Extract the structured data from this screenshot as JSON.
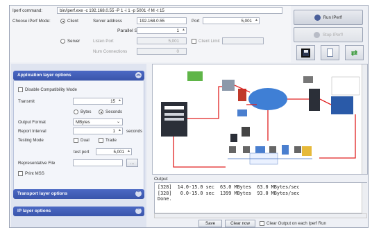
{
  "header": {
    "iperf_command_label": "Iperf command:",
    "iperf_command_value": "bin/iperf.exe -c 192.168.0.55 -P 1 -i 1 -p 5001 -f M -t 15",
    "choose_mode_label": "Choose iPerf Mode:",
    "client_label": "Client",
    "server_label": "Server",
    "server_address_label": "Server address",
    "server_address_value": "192.168.0.55",
    "port_label": "Port",
    "port_value": "5,001",
    "parallel_streams_label": "Parallel Streams",
    "parallel_streams_value": "1",
    "listen_port_label": "Listen Port",
    "listen_port_value": "5,001",
    "client_limit_label": "Client Limit",
    "num_connections_label": "Num Connections",
    "num_connections_value": "0"
  },
  "actions": {
    "run_label": "Run IPerf!",
    "stop_label": "Stop IPerf!"
  },
  "app_layer": {
    "title": "Application layer options",
    "disable_compat_label": "Disable Compatibility Mode",
    "transmit_label": "Transmit",
    "transmit_value": "15",
    "bytes_label": "Bytes",
    "seconds_label": "Seconds",
    "output_format_label": "Output Format",
    "output_format_value": "MBytes",
    "report_interval_label": "Report Interval",
    "report_interval_value": "1",
    "report_interval_unit": "seconds",
    "testing_mode_label": "Testing Mode",
    "dual_label": "Dual",
    "trade_label": "Trade",
    "test_port_label": "test port",
    "test_port_value": "5,001",
    "rep_file_label": "Representative File",
    "browse_label": "...",
    "print_mss_label": "Print MSS"
  },
  "transport_layer": {
    "title": "Transport layer options"
  },
  "ip_layer": {
    "title": "IP layer options"
  },
  "output": {
    "label": "Output",
    "lines": [
      "[328]  14.0-15.0 sec  63.0 MBytes  63.0 MBytes/sec",
      "[328]   0.0-15.0 sec  1399 MBytes  93.0 MBytes/sec",
      "Done."
    ],
    "save_label": "Save",
    "clear_label": "Clear now",
    "clear_each_label": "Clear Output on each Iperf Run"
  },
  "colors": {
    "section_header": "#3a55ab",
    "panel_bg": "#dfe4f0",
    "diagram_arrow": "#e02020"
  }
}
